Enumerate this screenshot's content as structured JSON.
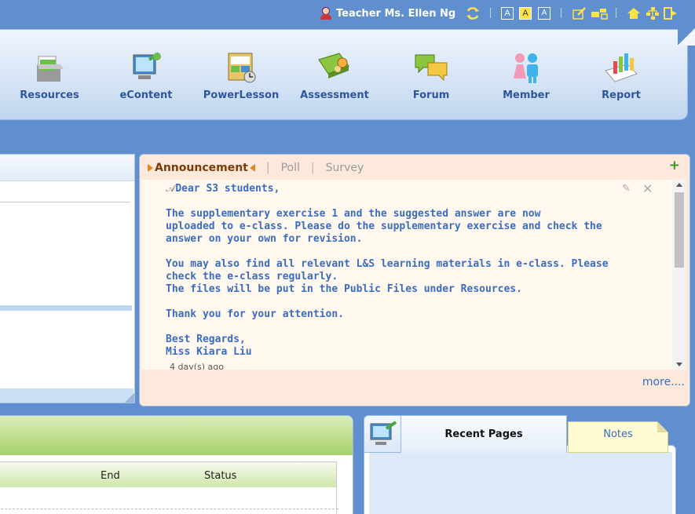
{
  "topbar": {
    "user_label": "Teacher Ms. Ellen Ng",
    "font_size_buttons": [
      "A",
      "A",
      "A"
    ],
    "icons": [
      "user-icon",
      "switch-icon",
      "font-large-icon",
      "font-medium-icon",
      "font-small-icon",
      "edit-icon",
      "tools-icon",
      "home-icon",
      "sitemap-icon",
      "logout-icon"
    ]
  },
  "modules": [
    {
      "label": "Resources",
      "icon": "resources-icon"
    },
    {
      "label": "eContent",
      "icon": "econtent-icon"
    },
    {
      "label": "PowerLesson",
      "icon": "powerlesson-icon"
    },
    {
      "label": "Assessment",
      "icon": "assessment-icon"
    },
    {
      "label": "Forum",
      "icon": "forum-icon"
    },
    {
      "label": "Member",
      "icon": "member-icon"
    },
    {
      "label": "Report",
      "icon": "report-icon"
    }
  ],
  "announcement": {
    "tabs": {
      "active": "Announcement",
      "poll": "Poll",
      "survey": "Survey"
    },
    "add_label": "+",
    "paragraphs": [
      "Dear S3 students,",
      "The supplementary exercise 1 and the suggested answer are now\nuploaded to e-class. Please do the supplementary exercise and check the\nanswer on your own for revision.",
      "You may also find all relevant L&S learning materials in e-class. Please\ncheck the e-class regularly.\nThe files will be put in the Public Files under Resources.",
      "Thank you for your attention.",
      "Best Regards,\nMiss Kiara Liu"
    ],
    "time": "4 day(s) ago",
    "more_label": "more...."
  },
  "schedule_table": {
    "headers": {
      "end": "End",
      "status": "Status"
    }
  },
  "recent": {
    "tab_recent": "Recent Pages",
    "tab_notes": "Notes"
  },
  "colors": {
    "background": "#5f8fcf",
    "link_blue": "#3b6bc2",
    "announcement_bg": "#fde9dc",
    "accent_orange": "#e08a1e",
    "green_header": "#a8d16c"
  }
}
